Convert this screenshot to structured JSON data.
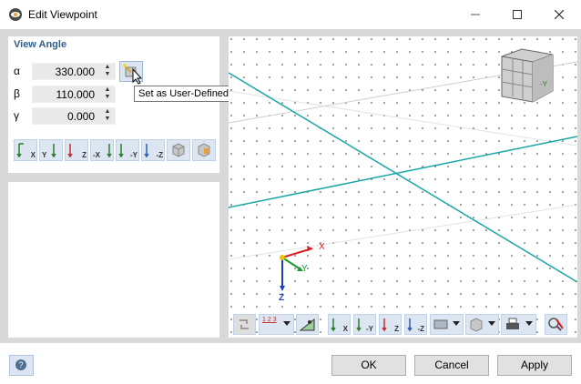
{
  "window": {
    "title": "Edit Viewpoint",
    "minimize_icon": "minimize-icon",
    "maximize_icon": "maximize-icon",
    "close_icon": "close-icon"
  },
  "view_angle": {
    "section_title": "View Angle",
    "fields": [
      {
        "symbol": "α",
        "value": "330.000"
      },
      {
        "symbol": "β",
        "value": "110.000"
      },
      {
        "symbol": "γ",
        "value": "0.000"
      }
    ],
    "user_defined_button_icon": "user-defined-direction-icon",
    "tooltip": "Set as User-Defined Direction"
  },
  "view_buttons": [
    {
      "name": "view-x",
      "label": "X"
    },
    {
      "name": "view-y",
      "label": "Y"
    },
    {
      "name": "view-z",
      "label": "Z"
    },
    {
      "name": "view-neg-x",
      "label": "-X"
    },
    {
      "name": "view-neg-y",
      "label": "-Y"
    },
    {
      "name": "view-neg-z",
      "label": "-Z"
    },
    {
      "name": "view-iso",
      "label": ""
    },
    {
      "name": "view-iso2",
      "label": ""
    }
  ],
  "viewport": {
    "axis_labels": {
      "x": "X",
      "y": "Y",
      "z": "Z"
    },
    "cube_label": "-Y"
  },
  "viewport_toolbar": {
    "numbering_text": "1 2 3",
    "buttons": [
      "X",
      "-Y",
      "Z",
      "-Z"
    ]
  },
  "footer": {
    "help_icon": "help-icon",
    "ok_label": "OK",
    "cancel_label": "Cancel",
    "apply_label": "Apply"
  },
  "colors": {
    "accent": "#2f5d8a",
    "grid_line": "#1aa6a6",
    "button_bg": "#dce6f2"
  }
}
